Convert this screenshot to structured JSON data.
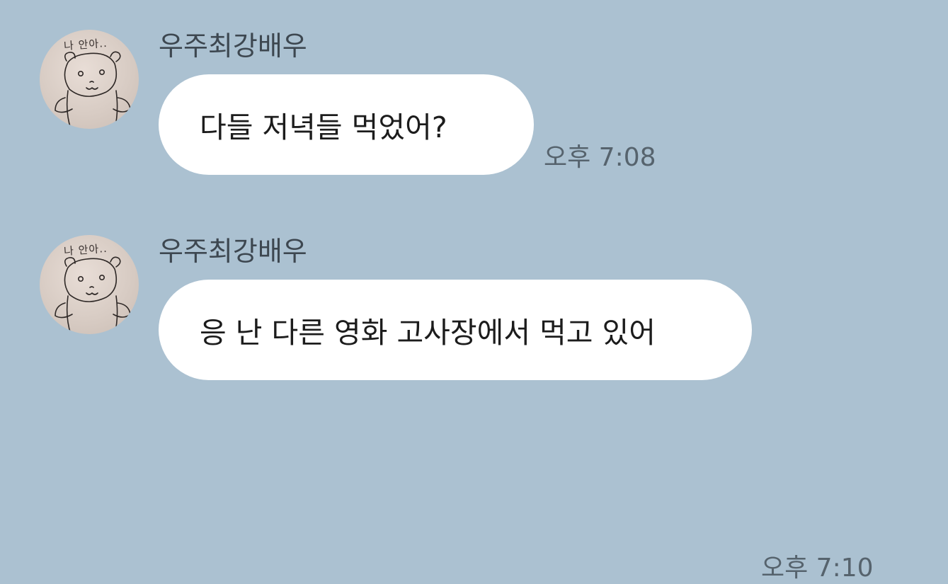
{
  "messages": [
    {
      "sender": "우주최강배우",
      "text": "다들 저녁들 먹었어?",
      "time": "오후 7:08",
      "avatar_caption": "나 안아.."
    },
    {
      "sender": "우주최강배우",
      "text": "응 난 다른 영화 고사장에서 먹고 있어",
      "time": "오후 7:10",
      "avatar_caption": "나 안아.."
    }
  ],
  "colors": {
    "background": "#abc1d1",
    "bubble": "#ffffff",
    "sender_text": "#3d4750",
    "time_text": "#56636d"
  },
  "icons": {
    "avatar": "hand-drawn-bear-avatar"
  }
}
